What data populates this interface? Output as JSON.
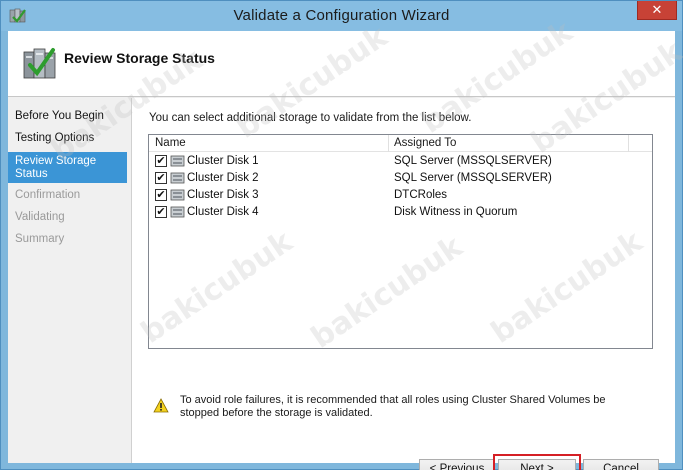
{
  "window": {
    "title": "Validate a Configuration Wizard",
    "close_symbol": "✕"
  },
  "header": {
    "title": "Review Storage Status",
    "icon": "cluster-validate-icon"
  },
  "nav": {
    "items": [
      {
        "label": "Before You Begin",
        "state": "normal"
      },
      {
        "label": "Testing Options",
        "state": "normal"
      },
      {
        "label": "Review Storage Status",
        "state": "active"
      },
      {
        "label": "Confirmation",
        "state": "disabled"
      },
      {
        "label": "Validating",
        "state": "disabled"
      },
      {
        "label": "Summary",
        "state": "disabled"
      }
    ]
  },
  "main": {
    "intro": "You can select additional storage to validate from the list below.",
    "columns": [
      "Name",
      "Assigned To"
    ],
    "rows": [
      {
        "checked": true,
        "name": "Cluster Disk 1",
        "assigned": "SQL Server (MSSQLSERVER)"
      },
      {
        "checked": true,
        "name": "Cluster Disk 2",
        "assigned": "SQL Server (MSSQLSERVER)"
      },
      {
        "checked": true,
        "name": "Cluster Disk 3",
        "assigned": "DTCRoles"
      },
      {
        "checked": true,
        "name": "Cluster Disk 4",
        "assigned": "Disk Witness in Quorum"
      }
    ],
    "check_mark": "✔",
    "warning": "To avoid role failures, it is recommended that all roles using Cluster Shared Volumes be stopped before the storage is validated."
  },
  "buttons": {
    "previous": "< Previous",
    "next": "Next >",
    "cancel": "Cancel"
  },
  "watermark": "bakicubuk",
  "colors": {
    "accent": "#3b95d6",
    "titlebar": "#86bde2",
    "close": "#c74236",
    "highlight": "#d51f25"
  }
}
